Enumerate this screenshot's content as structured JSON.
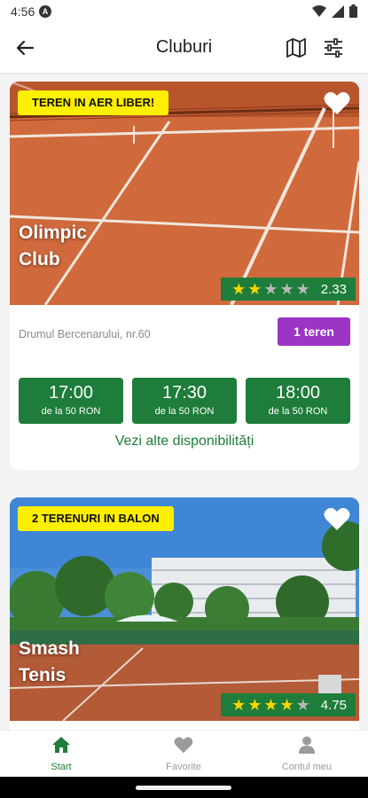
{
  "status_bar": {
    "time": "4:56",
    "app_icon_letter": "A"
  },
  "app_bar": {
    "title": "Cluburi",
    "icons": [
      "back-arrow-icon",
      "map-icon",
      "filter-icon"
    ]
  },
  "clubs": [
    {
      "badge": "TEREN IN AER LIBER!",
      "name_line1": "Olimpic",
      "name_line2": "Club",
      "rating": 2.33,
      "rating_text": "2.33",
      "stars_filled": 2,
      "address": "Drumul Bercenarului, nr.60",
      "courts": "1 teren",
      "slots": [
        {
          "time": "17:00",
          "price": "de la 50 RON"
        },
        {
          "time": "17:30",
          "price": "de la 50 RON"
        },
        {
          "time": "18:00",
          "price": "de la 50 RON"
        }
      ],
      "more_link": "Vezi alte disponibilități"
    },
    {
      "badge": "2 TERENURI IN BALON",
      "name_line1": "Smash",
      "name_line2": "Tenis",
      "rating": 4.75,
      "rating_text": "4.75",
      "stars_filled": 4
    }
  ],
  "bottom_nav": [
    {
      "label": "Start",
      "icon": "home-icon",
      "active": true
    },
    {
      "label": "Favorite",
      "icon": "heart-icon",
      "active": false
    },
    {
      "label": "Contul meu",
      "icon": "account-icon",
      "active": false
    }
  ],
  "colors": {
    "accent_green": "#1e7d3a",
    "badge_yellow": "#ffef00",
    "courts_purple": "#9d33c5",
    "clay": "#d06a3c"
  }
}
